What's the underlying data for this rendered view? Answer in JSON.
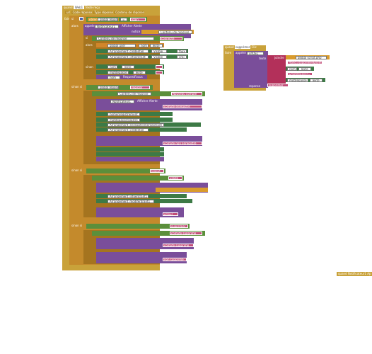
{
  "event_main": {
    "when": "quand",
    "component": "Web1",
    "event": "Texte reçu"
  },
  "params": [
    "url",
    "Code réponse",
    "Type réponse",
    "Contenu de réponse"
  ],
  "do": "faire",
  "if_kw": "si",
  "then_kw": "alors",
  "else_if_kw": "sinon si",
  "else_kw": "sinon",
  "get_kw": "obtenir",
  "set_kw": "mettre",
  "call_kw": "appeler",
  "to_kw": "à",
  "eq": "=",
  "global_reponse": "global reponse",
  "global_user": "global user",
  "contenu_reponse": "Contenu de réponse",
  "str_login": "login",
  "str_connecte": "connecté",
  "str_nouveau_compte": "Nouveau compte",
  "str_compte_enregistre": "compte enregistré",
  "str_compte_non_enregistre": "compte non enregistré",
  "str_register": "register",
  "str_logout": "logout",
  "str_valide": "validé",
  "str_erreur": "erreur",
  "str_supprimer": "supprimer",
  "str_compte_supprime": "compte supprimé",
  "str_non_supprime": "non supprimé",
  "notifier": "Notificateur1",
  "afficher_alerte": "Afficher Alerte",
  "notice": "notice",
  "nom": "nom",
  "texte": "Texte",
  "visible": "Visible",
  "faux": "faux",
  "vrai": "vrai",
  "empty": "",
  "arr_credentiel": "Arrangement_credentiel",
  "arr_infoentrant": "Arrangement_infoentrant",
  "arr_credentiel1": "Arrangement_credentiel1",
  "arr_infoentrant1": "Arrangement_infoentrant1",
  "arr_modifentrant1": "Arrangement_modifentrant1",
  "arr_enregistrement": "Arrangement_enregistrementantrant",
  "motdepasse": "motdepasse",
  "requestfocus": "RequestFocus",
  "nomenregistrement": "nomenregistrement",
  "motdepasseregistre": "motdepasseregistre",
  "event_supprimer": {
    "when": "quand",
    "component": "supprimer",
    "event": "Clic"
  },
  "call_post": "appeler",
  "web_post": "urlDEL",
  "text_post": "Poster Texte",
  "text_kw": "texte",
  "joindre": "joindre",
  "global_script": "global script.php",
  "str_delete_user": "?fonc=supprimer&nom=",
  "str_mdp": "&motdepasse=",
  "reponse_kw": "reponse",
  "str_supprimer2": "supprimer",
  "event_notif": {
    "when": "quand",
    "component": "Notificateur1",
    "event": "Ap"
  }
}
